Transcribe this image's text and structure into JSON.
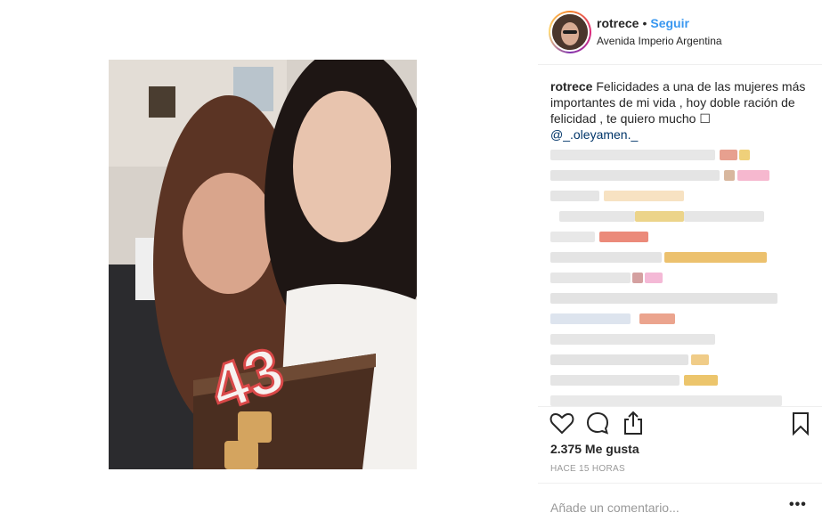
{
  "post": {
    "username": "rotrece",
    "follow_label": "Seguir",
    "separator": "•",
    "location": "Avenida Imperio Argentina",
    "caption_user": "rotrece",
    "caption_text": "Felicidades a una de las mujeres más importantes de mi vida , hoy doble ración de felicidad , te quiero mucho ☐",
    "caption_mention": "@_.oleyamen._",
    "likes": "2.375 Me gusta",
    "timestamp": "HACE 15 HORAS",
    "comment_placeholder": "Añade un comentario...",
    "more_label": "•••"
  },
  "icons": {
    "like": "heart-icon",
    "comment": "speech-bubble-icon",
    "share": "share-icon",
    "save": "bookmark-icon",
    "more": "ellipsis-icon"
  },
  "colors": {
    "link_blue": "#3897f0",
    "mention_blue": "#003569",
    "text": "#262626",
    "muted": "#999999"
  }
}
